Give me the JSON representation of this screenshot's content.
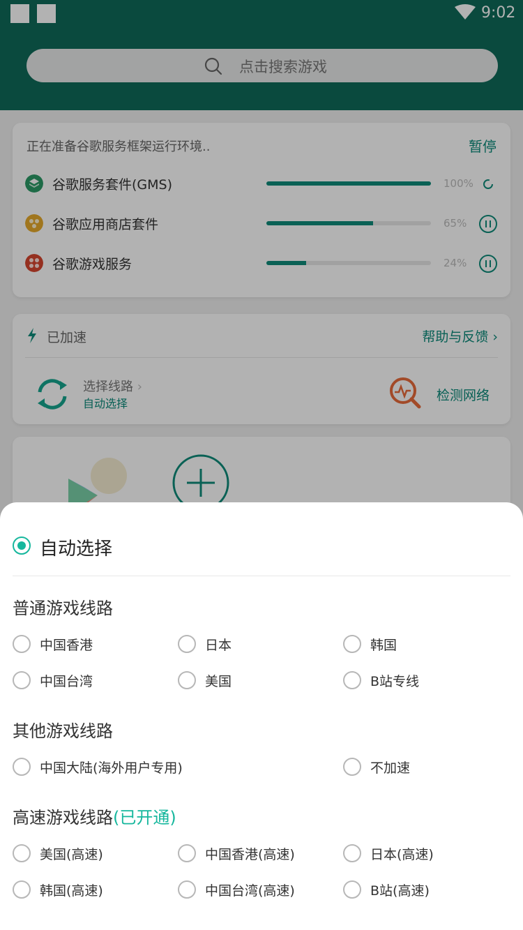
{
  "status_bar": {
    "time": "9:02"
  },
  "search": {
    "placeholder": "点击搜索游戏"
  },
  "prep_card": {
    "title": "正在准备谷歌服务框架运行环境..",
    "pause_label": "暂停",
    "services": [
      {
        "name": "谷歌服务套件(GMS)",
        "progress": 100,
        "progress_text": "100%",
        "icon": "gms-icon",
        "color": "#2b9a66"
      },
      {
        "name": "谷歌应用商店套件",
        "progress": 65,
        "progress_text": "65%",
        "icon": "store-icon",
        "color": "#e5a92c"
      },
      {
        "name": "谷歌游戏服务",
        "progress": 24,
        "progress_text": "24%",
        "icon": "games-icon",
        "color": "#d6452f"
      }
    ]
  },
  "accel_card": {
    "status": "已加速",
    "help_label": "帮助与反馈",
    "route_title": "选择线路",
    "route_value": "自动选择",
    "network_check": "检测网络"
  },
  "sheet": {
    "auto_option": "自动选择",
    "sections": [
      {
        "title": "普通游戏线路",
        "note": "",
        "options": [
          "中国香港",
          "日本",
          "韩国",
          "中国台湾",
          "美国",
          "B站专线"
        ]
      },
      {
        "title": "其他游戏线路",
        "note": "",
        "options": [
          "中国大陆(海外用户专用)",
          "不加速"
        ]
      },
      {
        "title": "高速游戏线路",
        "note": "(已开通)",
        "options": [
          "美国(高速)",
          "中国香港(高速)",
          "日本(高速)",
          "韩国(高速)",
          "中国台湾(高速)",
          "B站(高速)"
        ]
      }
    ]
  },
  "colors": {
    "brand": "#0f6a5a",
    "accent": "#16b79d",
    "link": "#0c8a7a"
  }
}
